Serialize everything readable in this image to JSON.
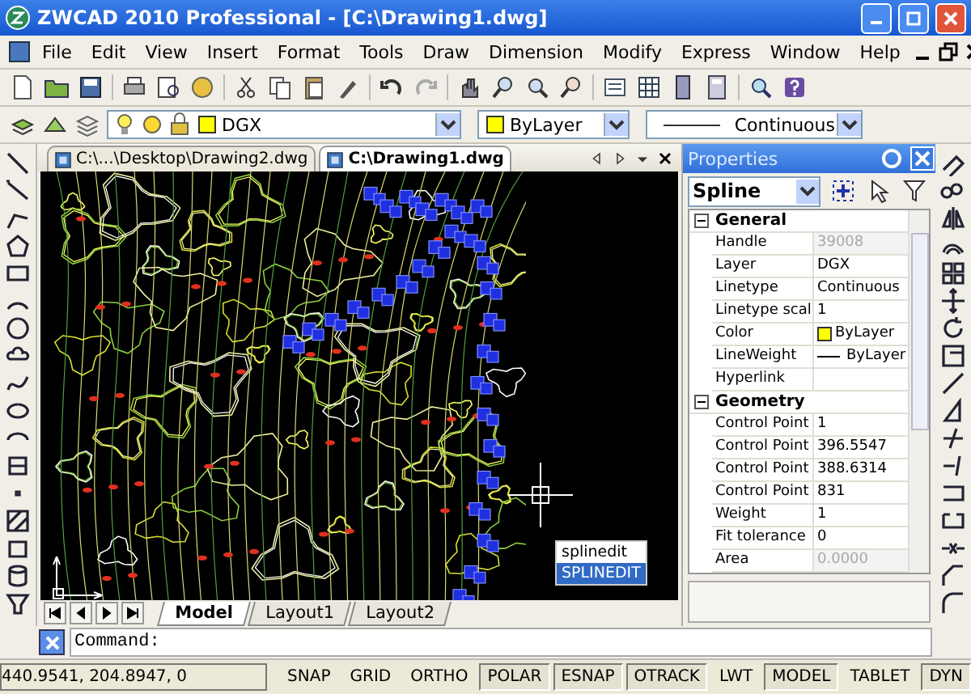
{
  "window": {
    "title": "ZWCAD 2010 Professional - [C:\\Drawing1.dwg]"
  },
  "menu": [
    "File",
    "Edit",
    "View",
    "Insert",
    "Format",
    "Tools",
    "Draw",
    "Dimension",
    "Modify",
    "Express",
    "Window",
    "Help"
  ],
  "layer_bar": {
    "layer": "DGX",
    "color_setting": "ByLayer",
    "linetype": "Continuous"
  },
  "document_tabs": [
    {
      "label": "C:\\...\\Desktop\\Drawing2.dwg",
      "selected": false
    },
    {
      "label": "C:\\Drawing1.dwg",
      "selected": true
    }
  ],
  "autocomplete": [
    {
      "label": "splinedit",
      "selected": false
    },
    {
      "label": "SPLINEDIT",
      "selected": true
    }
  ],
  "layout_tabs": [
    {
      "label": "Model",
      "selected": true
    },
    {
      "label": "Layout1",
      "selected": false
    },
    {
      "label": "Layout2",
      "selected": false
    }
  ],
  "properties": {
    "title": "Properties",
    "object_type": "Spline",
    "sections": [
      {
        "name": "General",
        "expanded": true,
        "rows": [
          {
            "label": "Handle",
            "value": "39008",
            "disabled": true,
            "kind": "text"
          },
          {
            "label": "Layer",
            "value": "DGX",
            "disabled": false,
            "kind": "text"
          },
          {
            "label": "Linetype",
            "value": "Continuous",
            "disabled": false,
            "kind": "text"
          },
          {
            "label": "Linetype scal",
            "value": "1",
            "disabled": false,
            "kind": "text"
          },
          {
            "label": "Color",
            "value": "ByLayer",
            "disabled": false,
            "kind": "color"
          },
          {
            "label": "LineWeight",
            "value": "ByLayer",
            "disabled": false,
            "kind": "lineweight"
          },
          {
            "label": "Hyperlink",
            "value": "",
            "disabled": false,
            "kind": "text"
          }
        ]
      },
      {
        "name": "Geometry",
        "expanded": true,
        "rows": [
          {
            "label": "Control Point",
            "value": "1",
            "disabled": false,
            "kind": "text"
          },
          {
            "label": "Control Point",
            "value": "396.5547",
            "disabled": false,
            "kind": "text"
          },
          {
            "label": "Control Point",
            "value": "388.6314",
            "disabled": false,
            "kind": "text"
          },
          {
            "label": "Control Point",
            "value": "831",
            "disabled": false,
            "kind": "text"
          },
          {
            "label": "Weight",
            "value": "1",
            "disabled": false,
            "kind": "text"
          },
          {
            "label": "Fit tolerance",
            "value": "0",
            "disabled": false,
            "kind": "text"
          },
          {
            "label": "Area",
            "value": "0.0000",
            "disabled": true,
            "kind": "text"
          }
        ]
      }
    ]
  },
  "command_line": {
    "prompt": "Command:"
  },
  "status_bar": {
    "coordinates": "440.9541, 204.8947, 0",
    "toggles": [
      {
        "label": "SNAP",
        "on": false
      },
      {
        "label": "GRID",
        "on": false
      },
      {
        "label": "ORTHO",
        "on": false
      },
      {
        "label": "POLAR",
        "on": true
      },
      {
        "label": "ESNAP",
        "on": true
      },
      {
        "label": "OTRACK",
        "on": true
      },
      {
        "label": "LWT",
        "on": false
      },
      {
        "label": "MODEL",
        "on": true
      },
      {
        "label": "TABLET",
        "on": false
      },
      {
        "label": "DYN",
        "on": true
      }
    ]
  }
}
